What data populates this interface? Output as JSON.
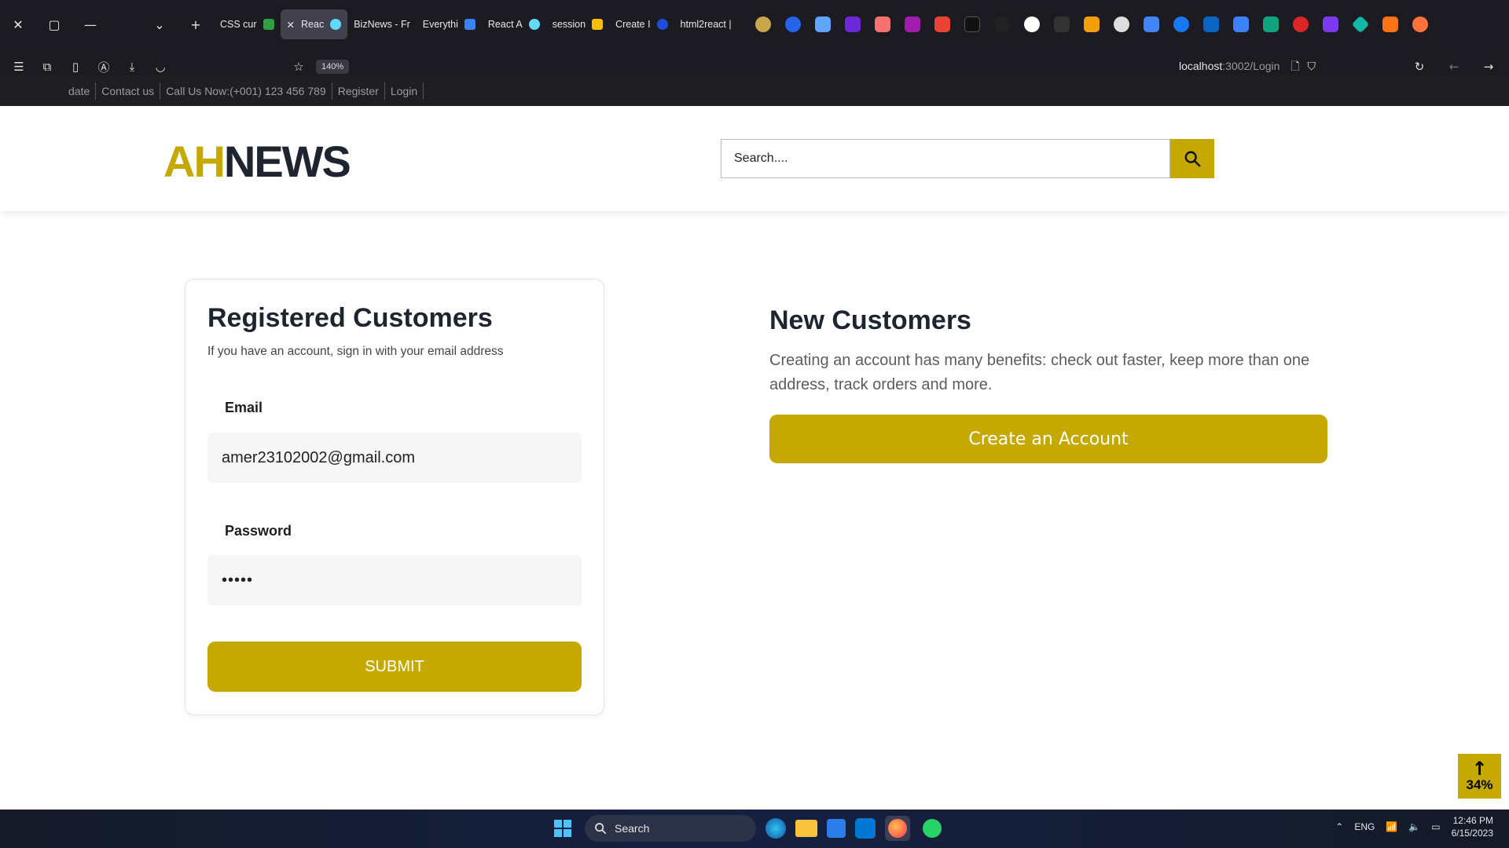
{
  "browser": {
    "tabs": [
      {
        "label": "CSS cur",
        "color": "#2ea043"
      },
      {
        "label": "Reac",
        "color": "#61dafb",
        "active": true
      },
      {
        "label": "BizNews - Fr",
        "color": "#3b82f6"
      },
      {
        "label": "Everythi",
        "color": "#3b82f6"
      },
      {
        "label": "React A",
        "color": "#61dafb"
      },
      {
        "label": "session",
        "color": "#fbbc04"
      },
      {
        "label": "Create I",
        "color": "#3b82f6"
      },
      {
        "label": "html2react |",
        "color": "#e6e6e6"
      }
    ],
    "zoom": "140%",
    "url_host": "localhost",
    "url_rest": ":3002/Login"
  },
  "topbar": {
    "links": [
      "date",
      "Contact us",
      "Call Us Now:(+001) 123 456 789",
      "Register",
      "Login"
    ]
  },
  "header": {
    "logo_ah": "AH",
    "logo_news": "NEWS",
    "search_placeholder": "Search...."
  },
  "login": {
    "title": "Registered Customers",
    "subtitle": "If you have an account, sign in with your email address",
    "email_label": "Email",
    "email_value": "amer23102002@gmail.com",
    "password_label": "Password",
    "password_value": "•••••",
    "submit_label": "SUBMIT"
  },
  "new_customers": {
    "title": "New Customers",
    "text": "Creating an account has many benefits: check out faster, keep more than one address, track orders and more.",
    "button_label": "Create an Account"
  },
  "scroll_top": {
    "percent": "34%"
  },
  "taskbar": {
    "search_label": "Search",
    "lang": "ENG",
    "time": "12:46 PM",
    "date": "6/15/2023"
  },
  "colors": {
    "accent": "#c5a800",
    "dark": "#1e2530"
  }
}
